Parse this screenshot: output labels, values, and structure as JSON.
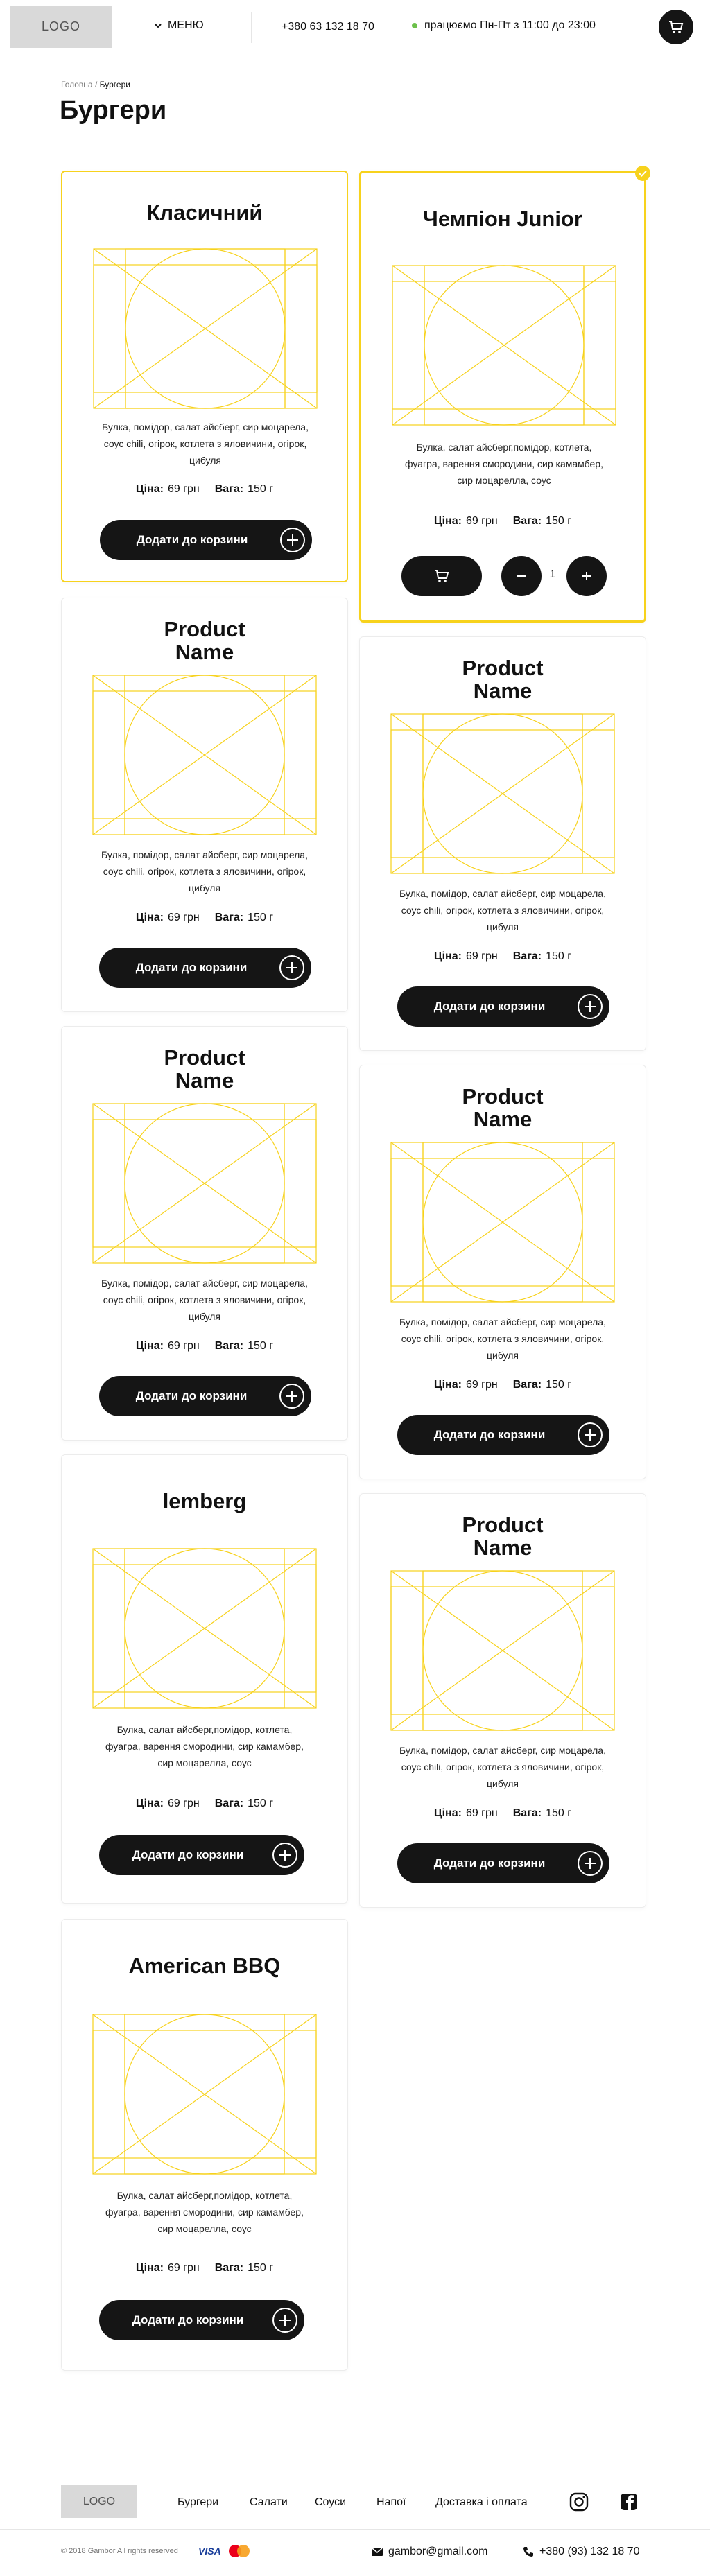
{
  "header": {
    "logo": "LOGO",
    "menu_label": "МЕНЮ",
    "phone": "+380 63 132 18 70",
    "hours_prefix": "працюємо Пн-Пт з",
    "hours_bold": "11:00 до 23:00",
    "status_color": "#6cc04a"
  },
  "breadcrumb": {
    "home": "Головна",
    "sep": "/",
    "current": "Бургери"
  },
  "page_title": "Бургери",
  "labels": {
    "price": "Ціна:",
    "weight": "Вага:",
    "add_to_cart": "Додати до корзини"
  },
  "accent_color": "#f7d21c",
  "products": [
    {
      "name": "Класичний",
      "desc": "Булка, помідор, салат айсберг, сир моцарела, соус chili, огірок, котлета з яловичини, огірок, цибуля",
      "price": "69 грн",
      "weight": "150 г"
    },
    {
      "name": "Чемпіон Junior",
      "desc": "Булка, салат айсберг,помідор, котлета, фуагра, варення смородини, сир камамбер, сир моцарелла, соус",
      "price": "69 грн",
      "weight": "150 г",
      "quantity": "1"
    },
    {
      "name": "Product Name",
      "desc": "Булка, помідор, салат айсберг, сир моцарела, соус chili, огірок, котлета з яловичини, огірок, цибуля",
      "price": "69 грн",
      "weight": "150 г"
    },
    {
      "name": "Product Name",
      "desc": "Булка, помідор, салат айсберг, сир моцарела, соус chili, огірок, котлета з яловичини, огірок, цибуля",
      "price": "69 грн",
      "weight": "150 г"
    },
    {
      "name": "Product Name",
      "desc": "Булка, помідор, салат айсберг, сир моцарела, соус chili, огірок, котлета з яловичини, огірок, цибуля",
      "price": "69 грн",
      "weight": "150 г"
    },
    {
      "name": "Product Name",
      "desc": "Булка, помідор, салат айсберг, сир моцарела, соус chili, огірок, котлета з яловичини, огірок, цибуля",
      "price": "69 грн",
      "weight": "150 г"
    },
    {
      "name": "lemberg",
      "desc": "Булка, салат айсберг,помідор, котлета, фуагра, варення смородини, сир камамбер, сир моцарелла, соус",
      "price": "69 грн",
      "weight": "150 г"
    },
    {
      "name": "Product Name",
      "desc": "Булка, помідор, салат айсберг, сир моцарела, соус chili, огірок, котлета з яловичини, огірок, цибуля",
      "price": "69 грн",
      "weight": "150 г"
    },
    {
      "name": "American BBQ",
      "desc": "Булка, салат айсберг,помідор, котлета, фуагра, варення смородини, сир камамбер, сир моцарелла, соус",
      "price": "69 грн",
      "weight": "150 г"
    }
  ],
  "footer": {
    "logo": "LOGO",
    "nav": [
      "Бургери",
      "Салати",
      "Соуси",
      "Напої",
      "Доставка і оплата"
    ],
    "social": [
      "instagram-icon",
      "facebook-icon"
    ],
    "copyright": "© 2018 Gambor All rights reserved",
    "payment_visa": "VISA",
    "email": "gambor@gmail.com",
    "phone": "+380 (93) 132 18 70"
  }
}
